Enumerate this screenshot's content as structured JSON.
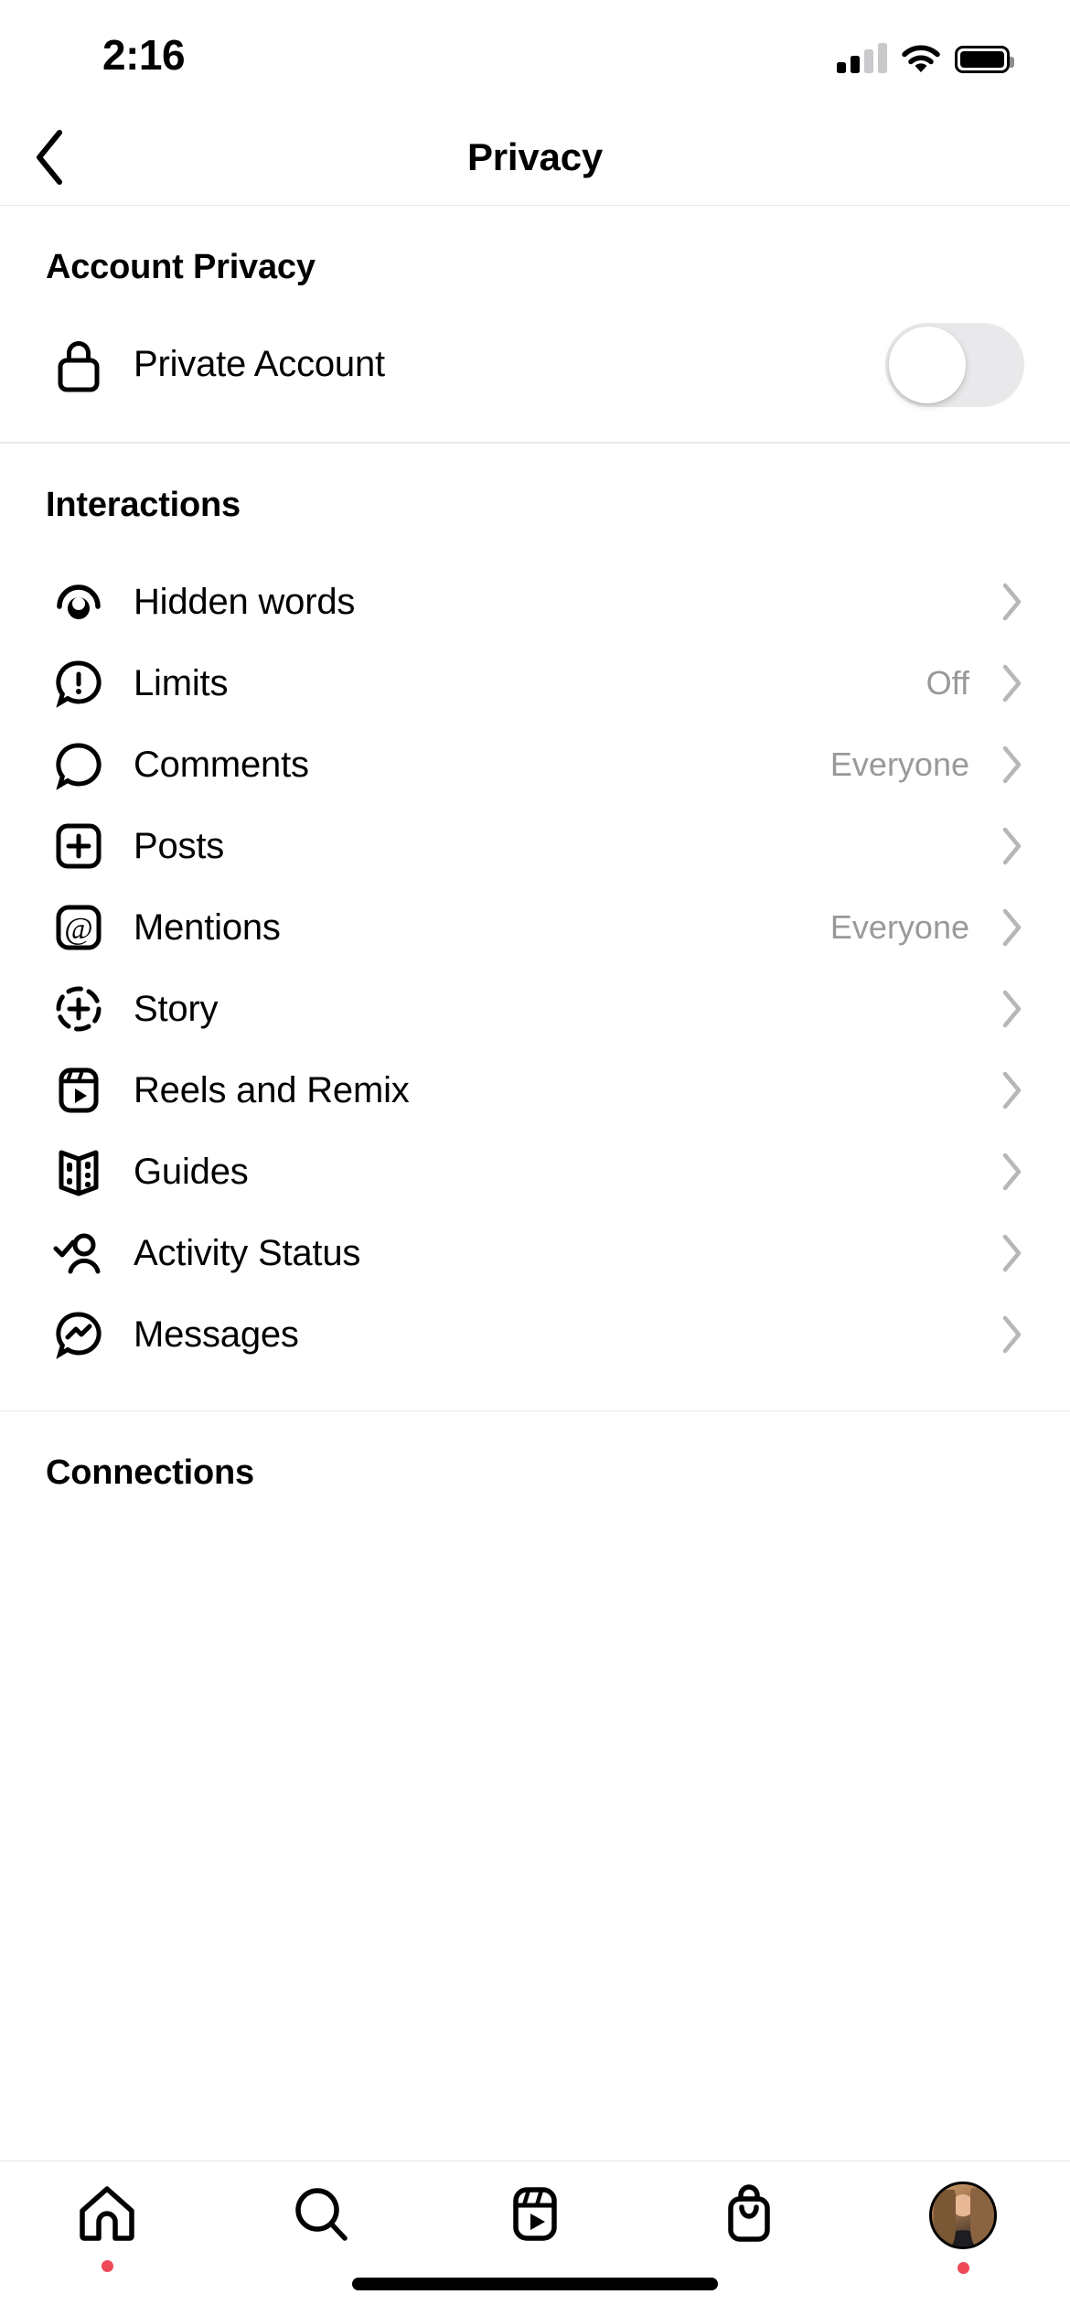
{
  "status_bar": {
    "time": "2:16",
    "signal_bars_filled": 2,
    "signal_bars_total": 4,
    "wifi_icon": "wifi-icon",
    "battery_icon": "battery-icon",
    "battery_level": 100
  },
  "nav": {
    "back_icon": "chevron-left-icon",
    "title": "Privacy"
  },
  "sections": [
    {
      "heading": "Account Privacy",
      "rows": [
        {
          "icon": "lock-icon",
          "label": "Private Account",
          "control": "toggle",
          "toggle_on": false,
          "value": ""
        }
      ]
    },
    {
      "heading": "Interactions",
      "rows": [
        {
          "icon": "hidden-words-icon",
          "label": "Hidden words",
          "control": "chevron",
          "value": ""
        },
        {
          "icon": "limits-icon",
          "label": "Limits",
          "control": "chevron",
          "value": "Off"
        },
        {
          "icon": "comments-icon",
          "label": "Comments",
          "control": "chevron",
          "value": "Everyone"
        },
        {
          "icon": "posts-icon",
          "label": "Posts",
          "control": "chevron",
          "value": ""
        },
        {
          "icon": "mentions-icon",
          "label": "Mentions",
          "control": "chevron",
          "value": "Everyone"
        },
        {
          "icon": "story-icon",
          "label": "Story",
          "control": "chevron",
          "value": ""
        },
        {
          "icon": "reels-icon",
          "label": "Reels and Remix",
          "control": "chevron",
          "value": ""
        },
        {
          "icon": "guides-icon",
          "label": "Guides",
          "control": "chevron",
          "value": ""
        },
        {
          "icon": "activity-status-icon",
          "label": "Activity Status",
          "control": "chevron",
          "value": ""
        },
        {
          "icon": "messages-icon",
          "label": "Messages",
          "control": "chevron",
          "value": ""
        }
      ]
    },
    {
      "heading": "Connections",
      "rows": []
    }
  ],
  "tab_bar": {
    "tabs": [
      {
        "icon": "home-icon",
        "name": "home",
        "badge": true
      },
      {
        "icon": "search-icon",
        "name": "search",
        "badge": false
      },
      {
        "icon": "reels-icon",
        "name": "reels",
        "badge": false
      },
      {
        "icon": "shop-icon",
        "name": "shop",
        "badge": false
      },
      {
        "icon": "avatar-icon",
        "name": "profile",
        "badge": true
      }
    ]
  },
  "colors": {
    "text": "#000000",
    "muted": "#999999",
    "divider": "#e8e8e8",
    "toggle_off_track": "#e9e9eb",
    "badge": "#ED4956"
  }
}
